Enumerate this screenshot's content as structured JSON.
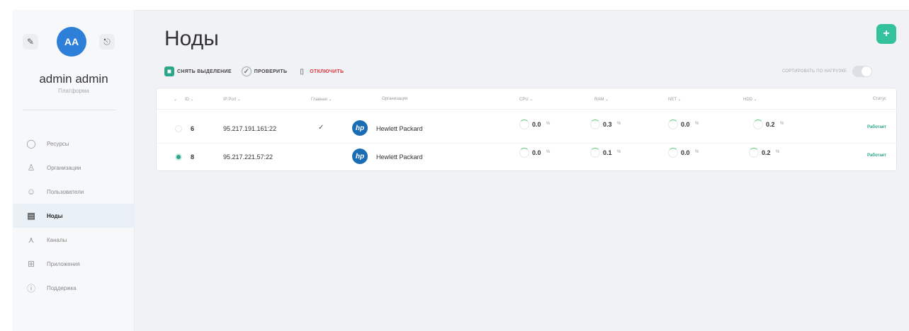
{
  "sidebar": {
    "avatar_initials": "AA",
    "user_name": "admin admin",
    "user_role": "Платформа",
    "items": [
      {
        "label": "Ресурсы",
        "icon": "circle-icon"
      },
      {
        "label": "Организации",
        "icon": "organization-icon"
      },
      {
        "label": "Пользователи",
        "icon": "users-icon"
      },
      {
        "label": "Ноды",
        "icon": "server-icon",
        "active": true
      },
      {
        "label": "Каналы",
        "icon": "network-icon"
      },
      {
        "label": "Приложения",
        "icon": "apps-icon"
      },
      {
        "label": "Поддержка",
        "icon": "info-icon"
      }
    ]
  },
  "page": {
    "title": "Ноды",
    "add_label": "+"
  },
  "toolbar": {
    "deselect_label": "СНЯТЬ ВЫДЕЛЕНИЕ",
    "check_label": "ПРОВЕРИТЬ",
    "disable_label": "ОТКЛЮЧИТЬ",
    "sort_label": "СОРТИРОВАТЬ ПО НАГРУЗКЕ"
  },
  "table": {
    "headers": {
      "id": "ID",
      "ip": "IP:Port",
      "main": "Главная",
      "org": "Организация",
      "cpu": "CPU",
      "ram": "RAM",
      "net": "NET",
      "hdd": "HDD",
      "status": "Статус"
    },
    "rows": [
      {
        "id": "6",
        "ip": "95.217.191.161:22",
        "main": "✓",
        "org": "Hewlett Packard",
        "cpu": "0.0",
        "ram": "0.3",
        "net": "0.0",
        "hdd": "0.2",
        "unit": "%",
        "status": "Работает",
        "selected": false
      },
      {
        "id": "8",
        "ip": "95.217.221.57:22",
        "main": "",
        "org": "Hewlett Packard",
        "cpu": "0.0",
        "ram": "0.1",
        "net": "0.0",
        "hdd": "0.2",
        "unit": "%",
        "status": "Работает",
        "selected": true
      }
    ]
  },
  "colors": {
    "accent": "#2ea58a",
    "danger": "#e0373b",
    "avatar": "#2d7fd8"
  }
}
